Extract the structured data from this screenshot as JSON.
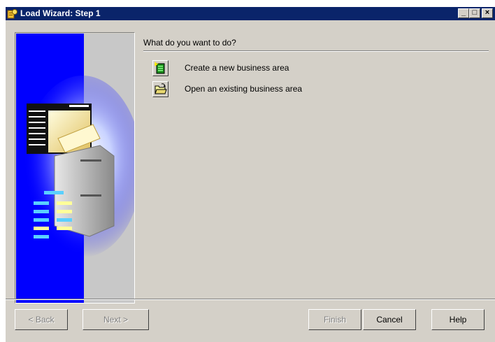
{
  "window": {
    "title": "Load Wizard: Step 1",
    "controls": {
      "minimize": "_",
      "maximize": "□",
      "close": "×"
    }
  },
  "main": {
    "question": "What do you want to do?",
    "options": [
      {
        "label": "Create a new business area",
        "icon": "new-business-area-icon"
      },
      {
        "label": "Open an existing business area",
        "icon": "open-folder-icon"
      }
    ]
  },
  "buttons": {
    "back": "< Back",
    "next": "Next >",
    "finish": "Finish",
    "cancel": "Cancel",
    "help": "Help"
  },
  "colors": {
    "titlebar": "#0a246a",
    "face": "#d4d0c8",
    "sidebar_blue": "#0000ff"
  }
}
